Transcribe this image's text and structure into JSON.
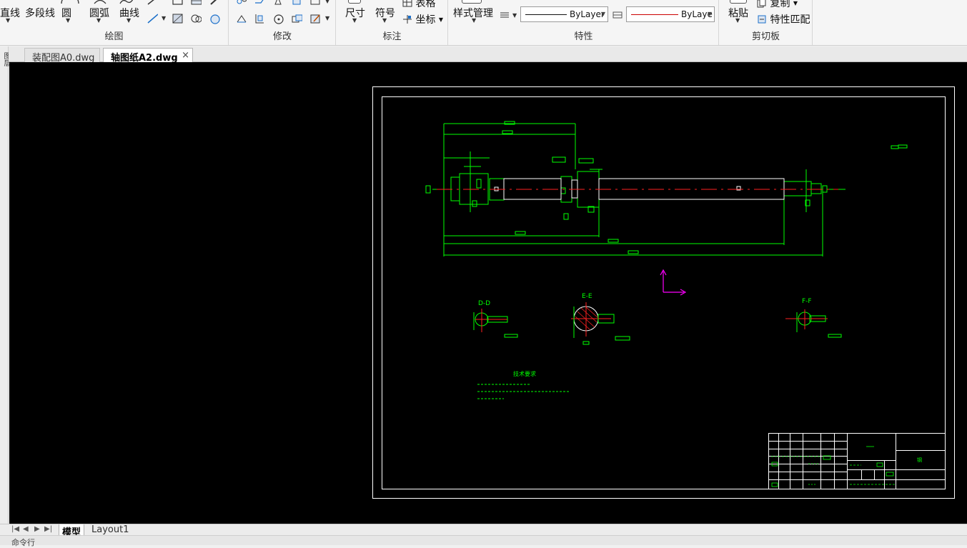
{
  "ribbon": {
    "draw_panel": {
      "title": "绘图",
      "line_label": "直线",
      "polyline_label": "多段线",
      "circle_label": "圆",
      "arc_label": "圆弧",
      "curve_label": "曲线"
    },
    "modify_panel": {
      "title": "修改"
    },
    "annotation_panel": {
      "title": "标注",
      "dimension_label": "尺寸",
      "symbol_label": "符号",
      "table_label": "表格",
      "coordinate_label": "坐标"
    },
    "properties_panel": {
      "title": "特性",
      "style_manager_label": "样式管理",
      "linetype_value": "ByLayer",
      "color_value": "ByLaye"
    },
    "clipboard_panel": {
      "title": "剪切板",
      "paste_label": "粘贴",
      "copy_label": "复制",
      "match_properties_label": "特性匹配"
    }
  },
  "tabs": [
    {
      "label": "装配图A0.dwg",
      "active": false
    },
    {
      "label": "轴图纸A2.dwg",
      "active": true
    }
  ],
  "tab_close_symbol": "×",
  "left_strip_label": "图层",
  "drawing": {
    "section_labels": {
      "d": "D-D",
      "e": "E-E",
      "f": "F-F"
    },
    "tech_title": "技术要求",
    "title_block_material": "钢"
  },
  "layout_tabs": [
    {
      "label": "模型",
      "active": true
    },
    {
      "label": "Layout1",
      "active": false
    }
  ],
  "command_prompt": "命令行",
  "colors": {
    "canvas_bg": "#000000",
    "geometry_green": "#00ff00",
    "geometry_white": "#ffffff",
    "centerline_red": "#ff2020",
    "ucs_magenta": "#ff00ff",
    "text_yellow": "#ffff00",
    "linetype_line_red": "#cc0000"
  }
}
